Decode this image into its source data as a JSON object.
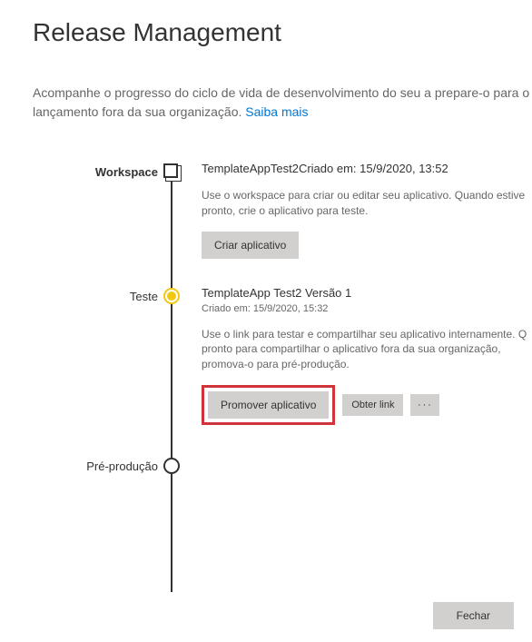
{
  "title": "Release Management",
  "intro_text_1": "Acompanhe o progresso do ciclo de vida de desenvolvimento do seu a",
  "intro_text_2": "prepare-o para o lançamento fora da sua organização. ",
  "intro_link": "Saiba mais",
  "stages": {
    "workspace": {
      "label": "Workspace",
      "title": "TemplateAppTest2Criado em: 15/9/2020, 13:52",
      "desc": "Use o workspace para criar ou editar seu aplicativo. Quando estive pronto, crie o aplicativo para teste.",
      "button": "Criar aplicativo"
    },
    "test": {
      "label": "Teste",
      "title": "TemplateApp Test2 Versão 1",
      "created": "Criado em: 15/9/2020, 15:32",
      "desc": "Use o link para testar e compartilhar seu aplicativo internamente. Q pronto para compartilhar o aplicativo fora da sua organização, promova-o para pré-produção.",
      "promote_btn": "Promover aplicativo",
      "link_btn": "Obter link",
      "more_btn": "···"
    },
    "preprod": {
      "label": "Pré-produção"
    }
  },
  "close_btn": "Fechar"
}
